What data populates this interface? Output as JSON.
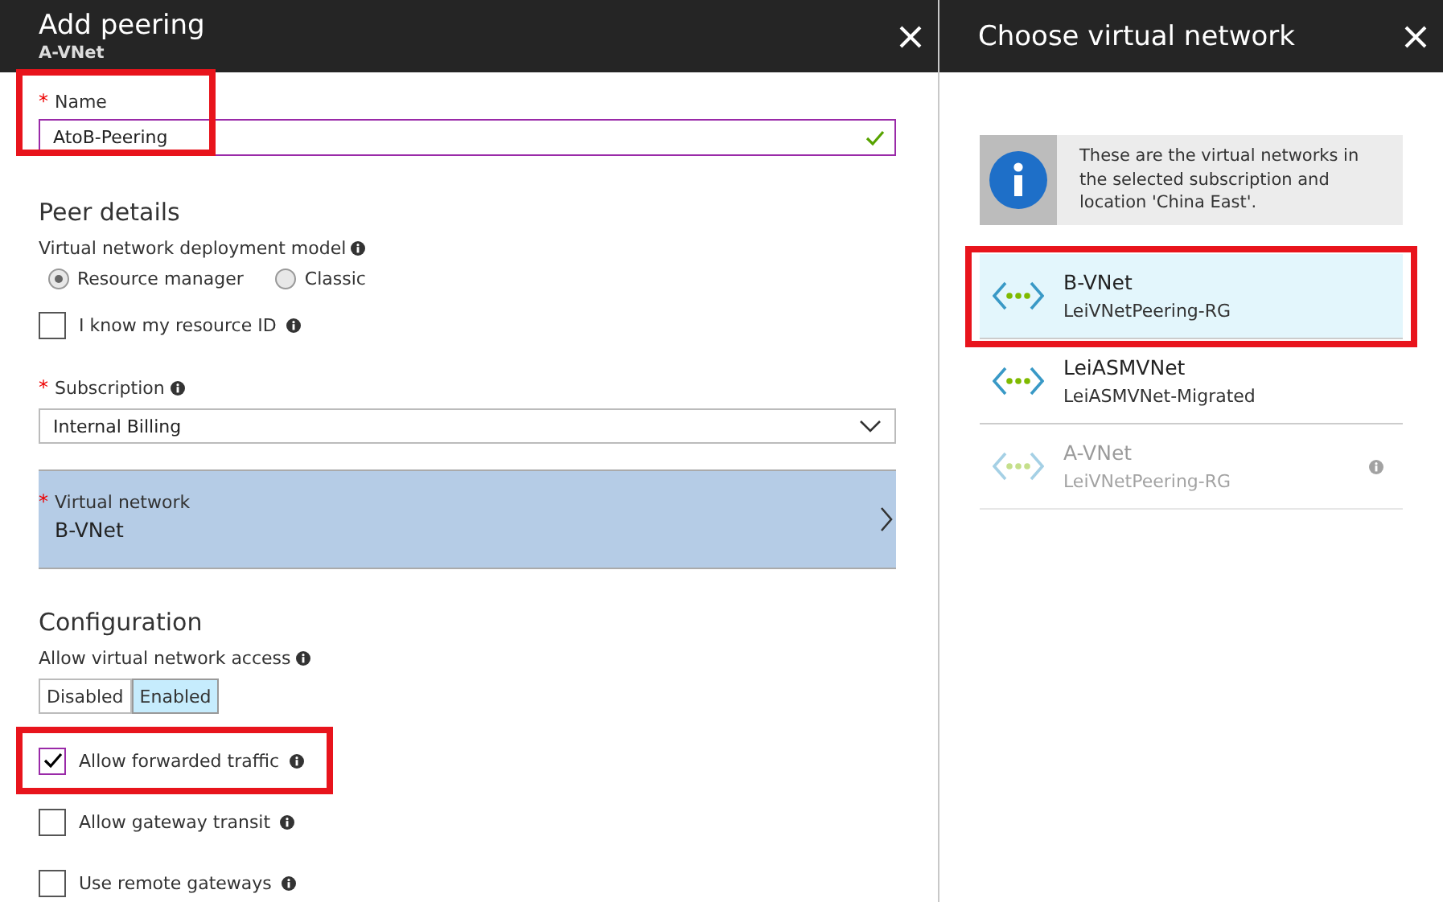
{
  "left_panel": {
    "title": "Add peering",
    "subtitle": "A-VNet",
    "name_field": {
      "required_mark": "*",
      "label": "Name",
      "value": "AtoB-Peering",
      "valid": true,
      "highlighted": true
    },
    "peer_details": {
      "heading": "Peer details",
      "deployment_model": {
        "label": "Virtual network deployment model",
        "options": [
          {
            "label": "Resource manager",
            "selected": true
          },
          {
            "label": "Classic",
            "selected": false
          }
        ]
      },
      "resource_id": {
        "label": "I know my resource ID",
        "checked": false
      },
      "subscription": {
        "required_mark": "*",
        "label": "Subscription",
        "value": "Internal Billing"
      },
      "virtual_network": {
        "required_mark": "*",
        "label": "Virtual network",
        "value": "B-VNet"
      }
    },
    "configuration": {
      "heading": "Configuration",
      "access": {
        "label": "Allow virtual network access",
        "options": [
          {
            "label": "Disabled",
            "selected": false
          },
          {
            "label": "Enabled",
            "selected": true
          }
        ]
      },
      "checkboxes": [
        {
          "label": "Allow forwarded traffic",
          "checked": true,
          "highlighted": true
        },
        {
          "label": "Allow gateway transit",
          "checked": false,
          "highlighted": false
        },
        {
          "label": "Use remote gateways",
          "checked": false,
          "highlighted": false
        }
      ]
    }
  },
  "right_panel": {
    "title": "Choose virtual network",
    "info": "These are the virtual networks in the selected subscription and location 'China East'.",
    "networks": [
      {
        "name": "B-VNet",
        "group": "LeiVNetPeering-RG",
        "selected": true,
        "disabled": false,
        "highlighted": true
      },
      {
        "name": "LeiASMVNet",
        "group": "LeiASMVNet-Migrated",
        "selected": false,
        "disabled": false,
        "highlighted": false
      },
      {
        "name": "A-VNet",
        "group": "LeiVNetPeering-RG",
        "selected": false,
        "disabled": true,
        "highlighted": false
      }
    ]
  }
}
